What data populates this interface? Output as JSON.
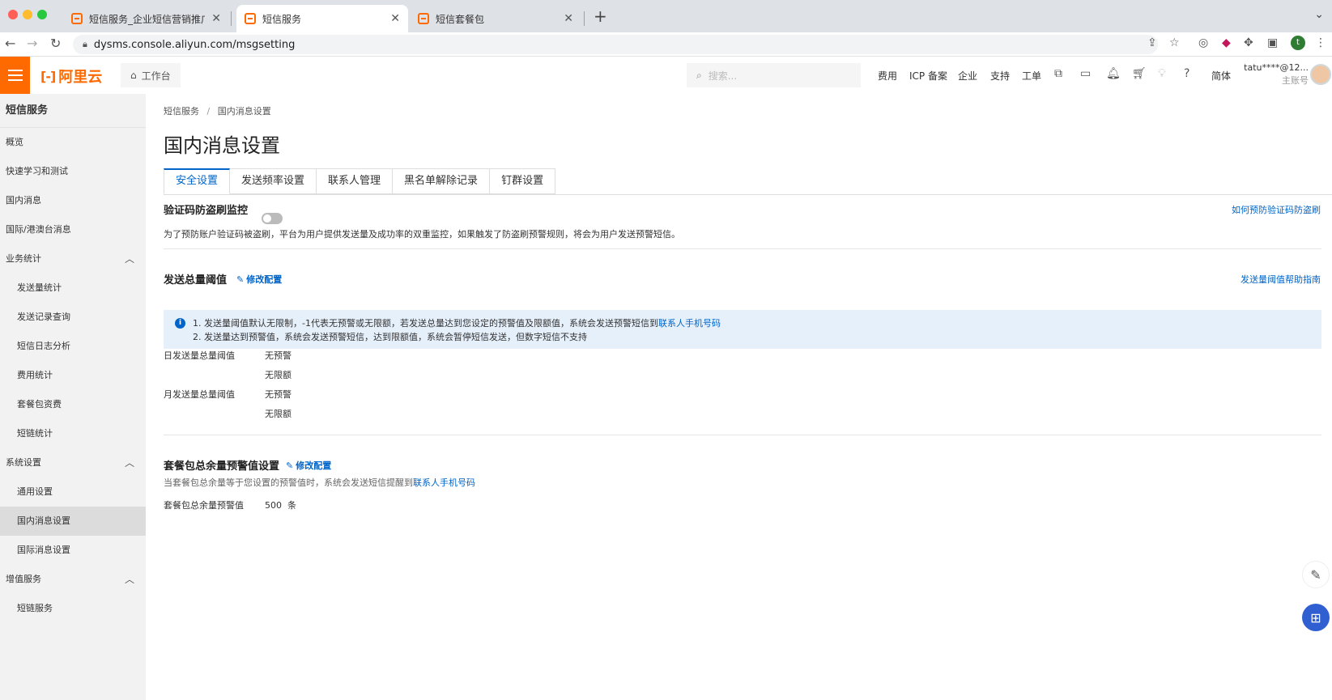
{
  "browser": {
    "tabs": [
      {
        "title": "短信服务_企业短信营销推广_验"
      },
      {
        "title": "短信服务"
      },
      {
        "title": "短信套餐包"
      }
    ],
    "url": "dysms.console.aliyun.com/msgsetting",
    "new_tab": "+",
    "profile_initial": "t"
  },
  "topbar": {
    "logo_text": "阿里云",
    "workbench": "工作台",
    "search_placeholder": "搜索...",
    "nav": [
      "费用",
      "ICP 备案",
      "企业",
      "支持",
      "工单"
    ],
    "lang": "简体",
    "user_account": "tatu****@12...",
    "user_role": "主账号"
  },
  "sidebar": {
    "title": "短信服务",
    "items": [
      {
        "label": "概览"
      },
      {
        "label": "快速学习和测试"
      },
      {
        "label": "国内消息"
      },
      {
        "label": "国际/港澳台消息"
      },
      {
        "label": "业务统计"
      },
      {
        "label": "发送量统计"
      },
      {
        "label": "发送记录查询"
      },
      {
        "label": "短信日志分析"
      },
      {
        "label": "费用统计"
      },
      {
        "label": "套餐包资费"
      },
      {
        "label": "短链统计"
      },
      {
        "label": "系统设置"
      },
      {
        "label": "通用设置"
      },
      {
        "label": "国内消息设置"
      },
      {
        "label": "国际消息设置"
      },
      {
        "label": "增值服务"
      },
      {
        "label": "短链服务"
      }
    ]
  },
  "breadcrumb": {
    "root": "短信服务",
    "sep": "/",
    "current": "国内消息设置"
  },
  "page_title": "国内消息设置",
  "tabs": [
    "安全设置",
    "发送频率设置",
    "联系人管理",
    "黑名单解除记录",
    "钉群设置"
  ],
  "captcha_section": {
    "title": "验证码防盗刷监控",
    "enabled": false,
    "help_link": "如何预防验证码防盗刷",
    "description": "为了预防账户验证码被盗刷，平台为用户提供发送量及成功率的双重监控，如果触发了防盗刷预警规则，将会为用户发送预警短信。"
  },
  "threshold_section": {
    "title": "发送总量阈值",
    "edit_label": "修改配置",
    "help_link": "发送量阈值帮助指南",
    "notice_line1": "1. 发送量阈值默认无限制，-1代表无预警或无限额，若发送总量达到您设定的预警值及限额值，系统会发送预警短信到",
    "notice_link": "联系人手机号码",
    "notice_line2": "2. 发送量达到预警值，系统会发送预警短信，达到限额值，系统会暂停短信发送，但数字短信不支持",
    "daily_label": "日发送量总量阈值",
    "daily_warn": "无预警",
    "daily_limit": "无限额",
    "monthly_label": "月发送量总量阈值",
    "monthly_warn": "无预警",
    "monthly_limit": "无限额"
  },
  "package_section": {
    "title": "套餐包总余量预警值设置",
    "edit_label": "修改配置",
    "description": "当套餐包总余量等于您设置的预警值时，系统会发送短信提醒到",
    "desc_link": "联系人手机号码",
    "warn_label": "套餐包总余量预警值",
    "warn_value": "500",
    "warn_unit": "条"
  },
  "colors": {
    "accent": "#0064c8",
    "brand": "#ff6a00"
  }
}
